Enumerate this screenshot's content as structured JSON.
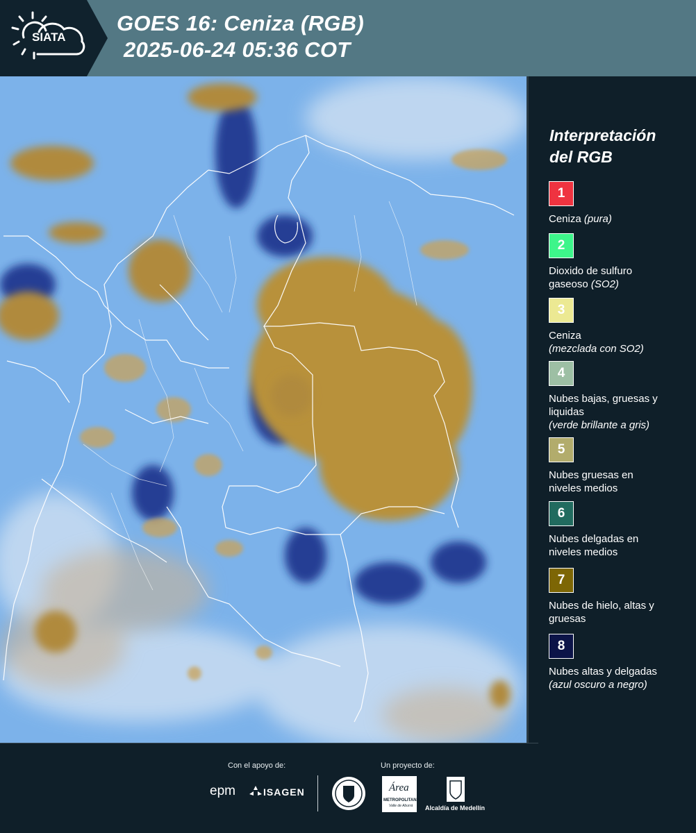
{
  "header": {
    "logo_text": "SIATA",
    "title": "GOES 16: Ceniza (RGB)",
    "timestamp": "2025-06-24 05:36 COT"
  },
  "legend": {
    "title_line1": "Interpretación",
    "title_line2": "del RGB",
    "items": [
      {
        "number": "1",
        "color": "#ef3340",
        "label": "Ceniza",
        "note": "(pura)"
      },
      {
        "number": "2",
        "color": "#3df58a",
        "label": "Dioxido de sulfuro gaseoso",
        "note": "(SO2)"
      },
      {
        "number": "3",
        "color": "#ece993",
        "label": "Ceniza",
        "note": "(mezclada con SO2)"
      },
      {
        "number": "4",
        "color": "#9dbfa4",
        "label": "Nubes bajas, gruesas y liquidas",
        "note": "(verde brillante a gris)"
      },
      {
        "number": "5",
        "color": "#b2ac6c",
        "label": "Nubes gruesas en niveles medios",
        "note": ""
      },
      {
        "number": "6",
        "color": "#216b5f",
        "label": "Nubes delgadas en niveles medios",
        "note": ""
      },
      {
        "number": "7",
        "color": "#7d6605",
        "label": "Nubes de hielo, altas y gruesas",
        "note": ""
      },
      {
        "number": "8",
        "color": "#0c1448",
        "label": "Nubes altas y delgadas",
        "note": "(azul oscuro a negro)"
      }
    ]
  },
  "footer": {
    "support_label": "Con el apoyo de:",
    "project_label": "Un proyecto de:",
    "epm": "epm",
    "isagen": "ISAGEN",
    "area_logo": "Área",
    "area_name": "METROPOLITANA",
    "area_sub": "Valle de Aburrá",
    "alcaldia": "Alcaldía de Medellín"
  }
}
